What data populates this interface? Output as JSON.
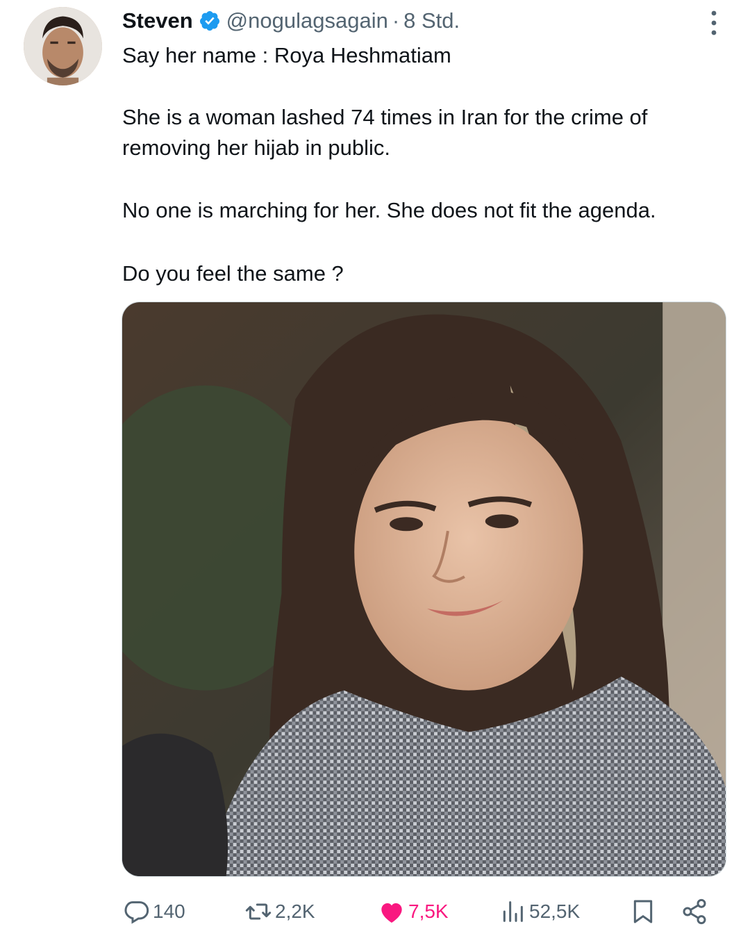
{
  "tweet": {
    "author": {
      "display_name": "Steven",
      "handle": "@nogulagsagain",
      "separator": "·",
      "time": "8 Std.",
      "verified": true
    },
    "text": {
      "line1": "Say her name : Roya Heshmatiam",
      "para2": "She is a woman lashed 74 times in Iran for the crime of removing her hijab in public.",
      "para3": "No one is marching for her. She does not fit the agenda.",
      "para4": "Do you feel the same ?"
    },
    "media": {
      "type": "photo",
      "subject": "portrait photo"
    },
    "actions": {
      "replies": "140",
      "reposts": "2,2K",
      "likes": "7,5K",
      "views": "52,5K"
    }
  },
  "colors": {
    "text_primary": "#0f1419",
    "text_secondary": "#536471",
    "verified_blue": "#1d9bf0",
    "like_pink": "#f91880",
    "border": "#cfd9de"
  },
  "icons": {
    "verified": "verified-badge-icon",
    "more": "more-options-icon",
    "reply": "reply-bubble-icon",
    "repost": "repost-arrows-icon",
    "like": "heart-icon",
    "views": "views-chart-icon",
    "bookmark": "bookmark-icon",
    "share": "share-icon"
  }
}
